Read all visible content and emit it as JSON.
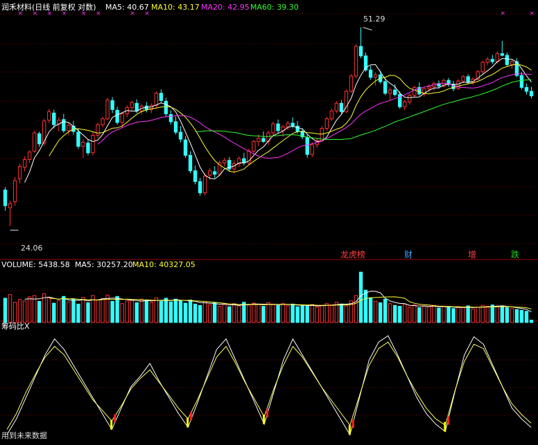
{
  "header": {
    "stock_title": "润禾材料(日线 前复权 对数)",
    "ma5": "MA5: 40.67",
    "ma10": "MA10: 43.17",
    "ma20": "MA20: 42.95",
    "ma60": "MA60: 39.30"
  },
  "volume_header": {
    "label": "VOLUME: 5438.58",
    "ma5": "MA5: 30257.20",
    "ma10": "MA10: 40327.05"
  },
  "indicator": {
    "title": "筹码比X",
    "footer": "用到未来数据"
  },
  "annotations": {
    "high": "51.29",
    "low": "24.06"
  },
  "events": [
    {
      "text": "龙虎榜",
      "color": "#ff4040"
    },
    {
      "text": "财",
      "color": "#40a0ff"
    },
    {
      "text": "增",
      "color": "#ff4040"
    },
    {
      "text": "跌",
      "color": "#20d020"
    }
  ],
  "colors": {
    "up": "#ff3333",
    "down": "#33ffff",
    "ma5": "#ffffff",
    "ma10": "#ffff33",
    "ma20": "#ff33ff",
    "ma60": "#33ff33",
    "title": "#ffffff",
    "grid": "#8b0000"
  },
  "chart_data": [
    {
      "type": "candlestick",
      "title": "润禾材料(日线 前复权 对数)",
      "log_scale": true,
      "ylim": [
        22.5,
        54
      ],
      "series": [
        {
          "name": "Candles",
          "ohlc": [
            [
              27.6,
              27.9,
              25.5,
              26.0
            ],
            [
              25.8,
              26.5,
              24.06,
              26.2
            ],
            [
              26.4,
              29.0,
              26.0,
              28.6
            ],
            [
              28.8,
              30.5,
              28.3,
              30.2
            ],
            [
              30.1,
              31.4,
              29.6,
              31.0
            ],
            [
              31.0,
              32.1,
              30.6,
              31.9
            ],
            [
              32.0,
              34.6,
              31.8,
              34.3
            ],
            [
              34.2,
              34.5,
              32.5,
              32.9
            ],
            [
              33.0,
              36.2,
              32.7,
              35.9
            ],
            [
              36.0,
              37.6,
              35.6,
              37.2
            ],
            [
              37.0,
              37.5,
              34.9,
              35.4
            ],
            [
              35.5,
              36.4,
              34.5,
              36.0
            ],
            [
              36.1,
              36.9,
              34.3,
              34.6
            ],
            [
              34.6,
              35.6,
              34.0,
              35.3
            ],
            [
              35.2,
              35.9,
              34.1,
              34.5
            ],
            [
              34.4,
              34.8,
              32.3,
              32.6
            ],
            [
              32.6,
              33.5,
              31.2,
              33.1
            ],
            [
              33.0,
              33.5,
              31.5,
              31.8
            ],
            [
              31.8,
              34.4,
              31.5,
              34.0
            ],
            [
              34.0,
              35.7,
              33.6,
              35.4
            ],
            [
              35.4,
              36.5,
              35.0,
              36.2
            ],
            [
              36.2,
              39.2,
              36.0,
              38.9
            ],
            [
              38.8,
              39.3,
              37.0,
              37.5
            ],
            [
              37.4,
              37.9,
              35.4,
              35.7
            ],
            [
              35.7,
              37.2,
              35.0,
              36.9
            ],
            [
              36.9,
              38.1,
              36.4,
              37.8
            ],
            [
              37.8,
              38.8,
              37.3,
              38.5
            ],
            [
              38.4,
              39.0,
              37.0,
              37.3
            ],
            [
              37.3,
              38.3,
              36.8,
              38.0
            ],
            [
              38.0,
              38.6,
              37.1,
              37.5
            ],
            [
              37.5,
              38.4,
              37.0,
              38.1
            ],
            [
              38.1,
              40.2,
              37.8,
              39.9
            ],
            [
              39.9,
              40.5,
              38.4,
              38.8
            ],
            [
              38.7,
              39.2,
              36.5,
              36.9
            ],
            [
              36.8,
              37.4,
              35.4,
              35.8
            ],
            [
              35.8,
              36.5,
              34.1,
              34.4
            ],
            [
              34.4,
              35.2,
              33.1,
              33.5
            ],
            [
              33.4,
              33.9,
              31.2,
              31.5
            ],
            [
              31.5,
              32.0,
              29.4,
              29.7
            ],
            [
              29.7,
              30.3,
              28.2,
              28.5
            ],
            [
              28.5,
              28.9,
              27.0,
              27.3
            ],
            [
              27.3,
              29.4,
              27.0,
              29.1
            ],
            [
              29.2,
              30.0,
              28.7,
              29.7
            ],
            [
              29.6,
              30.2,
              28.9,
              29.3
            ],
            [
              29.3,
              30.9,
              29.1,
              30.6
            ],
            [
              30.6,
              31.2,
              30.2,
              30.9
            ],
            [
              30.9,
              31.3,
              29.6,
              29.9
            ],
            [
              29.9,
              30.9,
              29.4,
              30.5
            ],
            [
              30.5,
              31.4,
              30.1,
              31.1
            ],
            [
              31.1,
              31.8,
              30.3,
              30.6
            ],
            [
              30.6,
              32.3,
              30.4,
              32.0
            ],
            [
              32.0,
              33.4,
              31.7,
              33.2
            ],
            [
              33.2,
              34.1,
              32.6,
              33.6
            ],
            [
              33.6,
              34.5,
              33.0,
              33.2
            ],
            [
              33.2,
              34.6,
              32.8,
              34.3
            ],
            [
              34.3,
              35.8,
              34.0,
              35.5
            ],
            [
              35.5,
              36.1,
              34.3,
              34.6
            ],
            [
              34.6,
              35.4,
              33.8,
              35.1
            ],
            [
              35.1,
              35.9,
              34.7,
              35.6
            ],
            [
              35.6,
              36.4,
              34.9,
              35.2
            ],
            [
              35.2,
              35.9,
              34.2,
              34.5
            ],
            [
              34.5,
              34.9,
              33.5,
              33.8
            ],
            [
              33.7,
              34.1,
              31.2,
              31.6
            ],
            [
              31.6,
              33.1,
              31.3,
              32.8
            ],
            [
              32.8,
              33.7,
              32.4,
              33.3
            ],
            [
              33.3,
              35.2,
              33.1,
              34.9
            ],
            [
              34.9,
              36.5,
              34.6,
              36.2
            ],
            [
              36.2,
              37.6,
              35.9,
              37.3
            ],
            [
              37.3,
              38.7,
              37.0,
              38.4
            ],
            [
              38.4,
              38.9,
              36.9,
              37.2
            ],
            [
              37.2,
              40.5,
              37.0,
              40.2
            ],
            [
              40.2,
              42.9,
              40.0,
              42.6
            ],
            [
              42.6,
              48.1,
              42.3,
              47.7
            ],
            [
              47.7,
              51.29,
              45.6,
              46.0
            ],
            [
              46.0,
              46.6,
              43.3,
              43.6
            ],
            [
              43.6,
              44.3,
              42.0,
              42.4
            ],
            [
              42.4,
              43.2,
              41.1,
              42.8
            ],
            [
              42.8,
              43.5,
              41.4,
              41.7
            ],
            [
              41.7,
              42.3,
              39.6,
              39.9
            ],
            [
              39.9,
              40.8,
              38.9,
              40.4
            ],
            [
              40.4,
              41.3,
              39.4,
              39.7
            ],
            [
              39.7,
              40.2,
              37.6,
              37.9
            ],
            [
              37.9,
              38.9,
              37.4,
              38.6
            ],
            [
              38.6,
              39.9,
              38.2,
              39.6
            ],
            [
              39.6,
              41.1,
              39.3,
              40.8
            ],
            [
              40.8,
              41.6,
              39.5,
              39.8
            ],
            [
              39.8,
              40.9,
              39.4,
              40.6
            ],
            [
              40.6,
              41.3,
              40.1,
              40.9
            ],
            [
              40.9,
              41.7,
              40.3,
              41.4
            ],
            [
              41.4,
              41.9,
              40.6,
              41.0
            ],
            [
              41.0,
              42.2,
              40.8,
              41.9
            ],
            [
              41.9,
              42.3,
              40.9,
              41.3
            ],
            [
              41.3,
              41.8,
              40.2,
              40.6
            ],
            [
              40.6,
              42.1,
              40.4,
              41.8
            ],
            [
              41.8,
              42.8,
              41.5,
              42.5
            ],
            [
              42.5,
              42.9,
              41.3,
              41.6
            ],
            [
              41.6,
              42.4,
              41.2,
              42.1
            ],
            [
              42.1,
              43.6,
              41.9,
              43.3
            ],
            [
              43.3,
              45.2,
              43.0,
              44.9
            ],
            [
              44.9,
              45.8,
              44.4,
              45.4
            ],
            [
              45.4,
              46.2,
              44.6,
              45.0
            ],
            [
              45.0,
              46.8,
              44.7,
              46.4
            ],
            [
              46.4,
              48.7,
              45.9,
              46.1
            ],
            [
              46.1,
              46.6,
              44.2,
              44.5
            ],
            [
              44.5,
              45.3,
              43.8,
              45.0
            ],
            [
              45.0,
              45.6,
              42.4,
              42.7
            ],
            [
              42.7,
              43.3,
              40.5,
              40.8
            ],
            [
              40.8,
              41.4,
              39.7,
              40.2
            ],
            [
              40.2,
              40.9,
              39.1,
              39.5
            ]
          ]
        }
      ]
    },
    {
      "type": "bar",
      "title": "VOLUME",
      "ylim": [
        0,
        120000
      ],
      "series": [
        {
          "name": "VOLUME",
          "values": [
            54000,
            62000,
            45000,
            51000,
            48000,
            57000,
            60000,
            47000,
            64000,
            55000,
            43000,
            49000,
            58000,
            46000,
            52000,
            41000,
            56000,
            44000,
            60000,
            50000,
            53000,
            61000,
            47000,
            58000,
            42000,
            48000,
            51000,
            44000,
            52000,
            49000,
            45000,
            55000,
            47000,
            54000,
            46000,
            52000,
            49000,
            43000,
            50000,
            41000,
            38000,
            47000,
            39000,
            44000,
            36000,
            40000,
            35000,
            42000,
            37000,
            45000,
            39000,
            43000,
            41000,
            36000,
            44000,
            40000,
            38000,
            42000,
            37000,
            41000,
            35000,
            39000,
            36000,
            40000,
            34000,
            38000,
            42000,
            39000,
            45000,
            41000,
            37000,
            48000,
            60000,
            112000,
            72000,
            55000,
            47000,
            44000,
            52000,
            42000,
            38000,
            36000,
            41000,
            34000,
            39000,
            33000,
            37000,
            35000,
            38000,
            32000,
            36000,
            34000,
            31000,
            35000,
            33000,
            37000,
            30000,
            34000,
            38000,
            36000,
            39000,
            35000,
            37000,
            33000,
            31000,
            29000,
            27000,
            25000,
            5438.58
          ]
        },
        {
          "name": "MA5",
          "values": []
        },
        {
          "name": "MA10",
          "values": []
        }
      ]
    },
    {
      "type": "line",
      "title": "筹码比X",
      "ylim": [
        0,
        100
      ],
      "series": [
        {
          "name": "",
          "values": [
            5,
            20,
            40,
            60,
            80,
            95,
            85,
            70,
            55,
            40,
            25,
            10,
            30,
            50,
            60,
            72,
            55,
            40,
            25,
            12,
            35,
            60,
            85,
            95,
            75,
            55,
            35,
            15,
            45,
            75,
            95,
            80,
            65,
            50,
            35,
            20,
            5,
            40,
            75,
            92,
            98,
            80,
            60,
            40,
            25,
            15,
            8,
            45,
            80,
            97,
            90,
            70,
            50,
            30,
            20,
            12
          ]
        },
        {
          "name": "",
          "values": [
            10,
            25,
            45,
            62,
            78,
            88,
            80,
            66,
            52,
            38,
            28,
            18,
            32,
            48,
            58,
            66,
            54,
            42,
            30,
            20,
            38,
            58,
            78,
            88,
            72,
            54,
            38,
            22,
            48,
            70,
            88,
            78,
            64,
            50,
            38,
            26,
            14,
            42,
            70,
            86,
            92,
            78,
            60,
            44,
            30,
            20,
            14,
            46,
            74,
            90,
            86,
            68,
            50,
            34,
            24,
            16
          ]
        }
      ]
    }
  ]
}
